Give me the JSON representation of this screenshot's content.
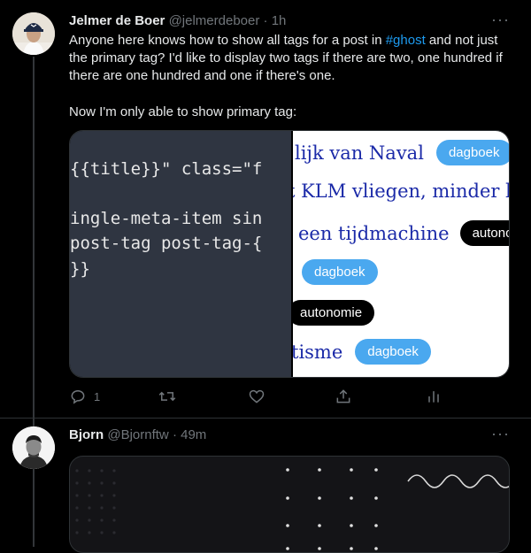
{
  "tweets": [
    {
      "author_name": "Jelmer de Boer",
      "handle": "@jelmerdeboer",
      "dot": "·",
      "time": "1h",
      "more": "···",
      "text_before": "Anyone here knows how to show all tags for a post in ",
      "hashtag": "#ghost",
      "text_after": " and not just the primary tag? I'd like to display two tags if there are two, one hundred if there are one hundred and one if there's one.",
      "text_second": "Now I'm only able to show primary tag:",
      "media": {
        "code_lines": [
          "{{title}}\" class=\"f",
          "ingle-meta-item sin",
          "post-tag post-tag-{",
          "}}"
        ],
        "preview_rows": [
          {
            "text": "lijk van Naval",
            "tag": "dagboek",
            "tag_color": "blue"
          },
          {
            "text": "t KLM vliegen, minder beta",
            "tag": "",
            "tag_color": ""
          },
          {
            "text": "een tijdmachine",
            "tag": "autonomie",
            "tag_color": "black"
          },
          {
            "text": "",
            "tag": "dagboek",
            "tag_color": "blue"
          },
          {
            "text": "",
            "tag": "autonomie",
            "tag_color": "black"
          },
          {
            "text": "tisme",
            "tag": "dagboek",
            "tag_color": "blue"
          }
        ]
      },
      "actions": {
        "reply_count": "1"
      }
    },
    {
      "author_name": "Bjorn",
      "handle": "@Bjornftw",
      "dot": "·",
      "time": "49m",
      "more": "···"
    }
  ],
  "colors": {
    "background": "#000000",
    "text": "#e7e9ea",
    "muted": "#71767b",
    "accent": "#1d9bf0",
    "tag_blue": "#4aa8ef",
    "link_serif": "#1b2aa8",
    "code_bg": "#2f3541"
  },
  "icons": [
    "reply-icon",
    "retweet-icon",
    "like-icon",
    "share-icon",
    "analytics-icon",
    "more-icon"
  ]
}
